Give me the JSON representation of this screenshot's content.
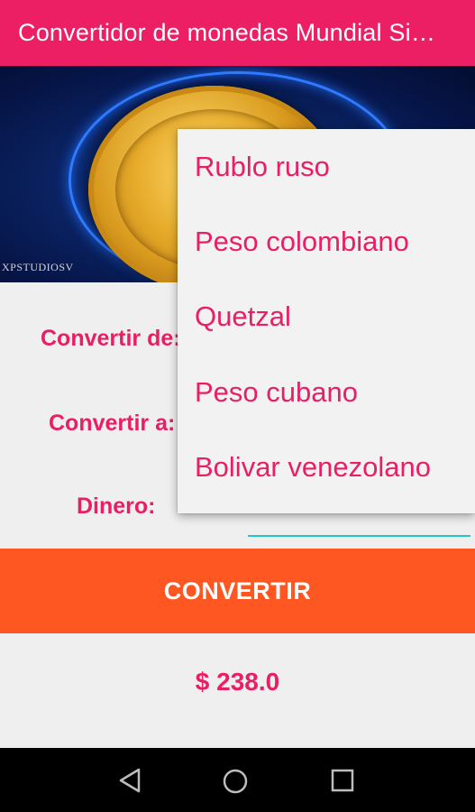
{
  "app_bar": {
    "title": "Convertidor de monedas Mundial Sin Internet"
  },
  "banner": {
    "tag": "XPSTUDIOSV",
    "coin_symbol": "$"
  },
  "form": {
    "from_label": "Convertir de:",
    "to_label": "Convertir a:",
    "money_label": "Dinero:",
    "money_value": ""
  },
  "convert_button": {
    "label": "CONVERTIR"
  },
  "result": {
    "text": "$ 238.0"
  },
  "dropdown": {
    "items": [
      {
        "label": "Rublo ruso"
      },
      {
        "label": "Peso colombiano"
      },
      {
        "label": "Quetzal"
      },
      {
        "label": "Peso cubano"
      },
      {
        "label": "Bolivar venezolano"
      }
    ]
  },
  "nav": {
    "icons": [
      "back-icon",
      "home-icon",
      "recents-icon"
    ]
  },
  "colors": {
    "primary": "#ec1e64",
    "accent": "#ff5722",
    "text_accent": "#e91e63",
    "underline": "#26c6c6"
  }
}
